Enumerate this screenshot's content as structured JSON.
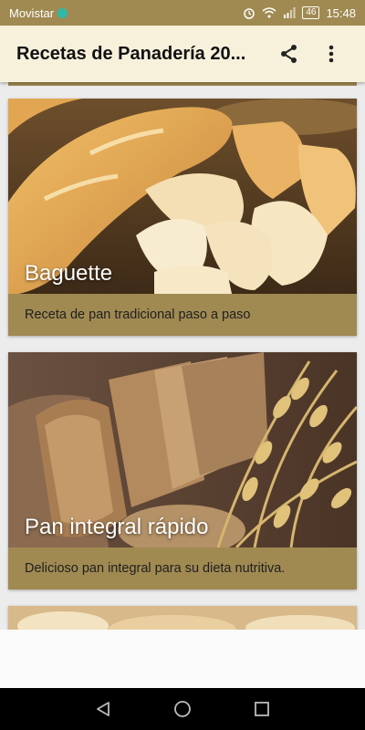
{
  "status_bar": {
    "carrier": "Movistar",
    "battery": "46",
    "time": "15:48"
  },
  "app_bar": {
    "title": "Recetas de Panadería 20..."
  },
  "colors": {
    "accent": "#a08a52",
    "app_bar_bg": "#f7f1dc",
    "page_bg": "#ececec"
  },
  "icons": {
    "share": "share-icon",
    "more": "more-vert-icon",
    "back": "back-triangle-icon",
    "home": "home-circle-icon",
    "recents": "recents-square-icon"
  },
  "recipes": [
    {
      "title": "Baguette",
      "description": "Receta de pan tradicional paso a paso"
    },
    {
      "title": "Pan integral rápido",
      "description": "Delicioso pan integral para su dieta nutritiva."
    }
  ]
}
